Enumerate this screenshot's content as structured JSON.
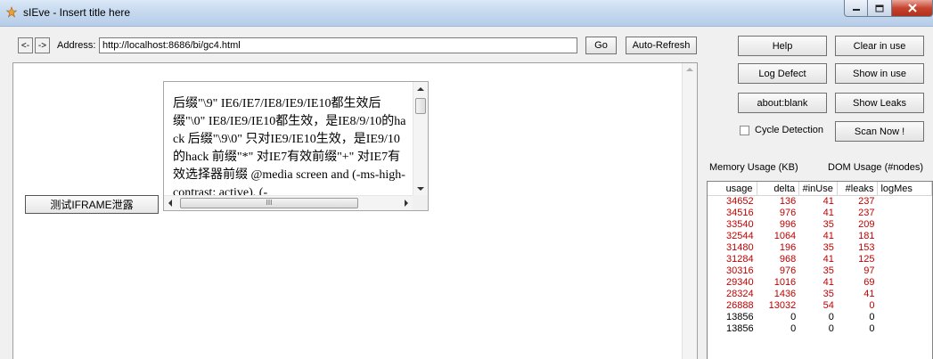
{
  "window": {
    "title": "sIEve - Insert title here"
  },
  "toolbar": {
    "back_label": "<-",
    "forward_label": "->",
    "address_label": "Address:",
    "address_value": "http://localhost:8686/bi/gc4.html",
    "go_label": "Go",
    "autorefresh_label": "Auto-Refresh"
  },
  "page": {
    "frame_button_label": "测试IFRAME泄露",
    "iframe_text": "后缀\"\\9\" IE6/IE7/IE8/IE9/IE10都生效后缀\"\\0\" IE8/IE9/IE10都生效，是IE8/9/10的hack 后缀\"\\9\\0\" 只对IE9/IE10生效，是IE9/10的hack 前缀\"*\" 对IE7有效前缀\"+\" 对IE7有效选择器前缀  @media screen and (-ms-high-contrast: active), (-",
    "scroll_thumb_glyph": "III"
  },
  "panel": {
    "help_label": "Help",
    "clear_in_use_label": "Clear in use",
    "log_defect_label": "Log Defect",
    "show_in_use_label": "Show in use",
    "about_blank_label": "about:blank",
    "show_leaks_label": "Show Leaks",
    "cycle_detection_label": "Cycle Detection",
    "scan_now_label": "Scan Now !",
    "memory_usage_label": "Memory Usage (KB)",
    "dom_usage_label": "DOM Usage (#nodes)"
  },
  "grid": {
    "columns": [
      "usage",
      "delta",
      "#inUse",
      "#leaks",
      "logMes"
    ],
    "rows": [
      {
        "usage": "34652",
        "delta": "136",
        "inuse": "41",
        "leaks": "237",
        "color": "#c00000"
      },
      {
        "usage": "34516",
        "delta": "976",
        "inuse": "41",
        "leaks": "237",
        "color": "#c00000"
      },
      {
        "usage": "33540",
        "delta": "996",
        "inuse": "35",
        "leaks": "209",
        "color": "#c00000"
      },
      {
        "usage": "32544",
        "delta": "1064",
        "inuse": "41",
        "leaks": "181",
        "color": "#c00000"
      },
      {
        "usage": "31480",
        "delta": "196",
        "inuse": "35",
        "leaks": "153",
        "color": "#c00000"
      },
      {
        "usage": "31284",
        "delta": "968",
        "inuse": "41",
        "leaks": "125",
        "color": "#c00000"
      },
      {
        "usage": "30316",
        "delta": "976",
        "inuse": "35",
        "leaks": "97",
        "color": "#c00000"
      },
      {
        "usage": "29340",
        "delta": "1016",
        "inuse": "41",
        "leaks": "69",
        "color": "#c00000"
      },
      {
        "usage": "28324",
        "delta": "1436",
        "inuse": "35",
        "leaks": "41",
        "color": "#c00000"
      },
      {
        "usage": "26888",
        "delta": "13032",
        "inuse": "54",
        "leaks": "0",
        "color": "#c00000"
      },
      {
        "usage": "13856",
        "delta": "0",
        "inuse": "0",
        "leaks": "0",
        "color": "#000000"
      },
      {
        "usage": "13856",
        "delta": "0",
        "inuse": "0",
        "leaks": "0",
        "color": "#000000"
      }
    ]
  },
  "colors": {
    "leak_row": "#c00000",
    "normal_row": "#000000"
  }
}
